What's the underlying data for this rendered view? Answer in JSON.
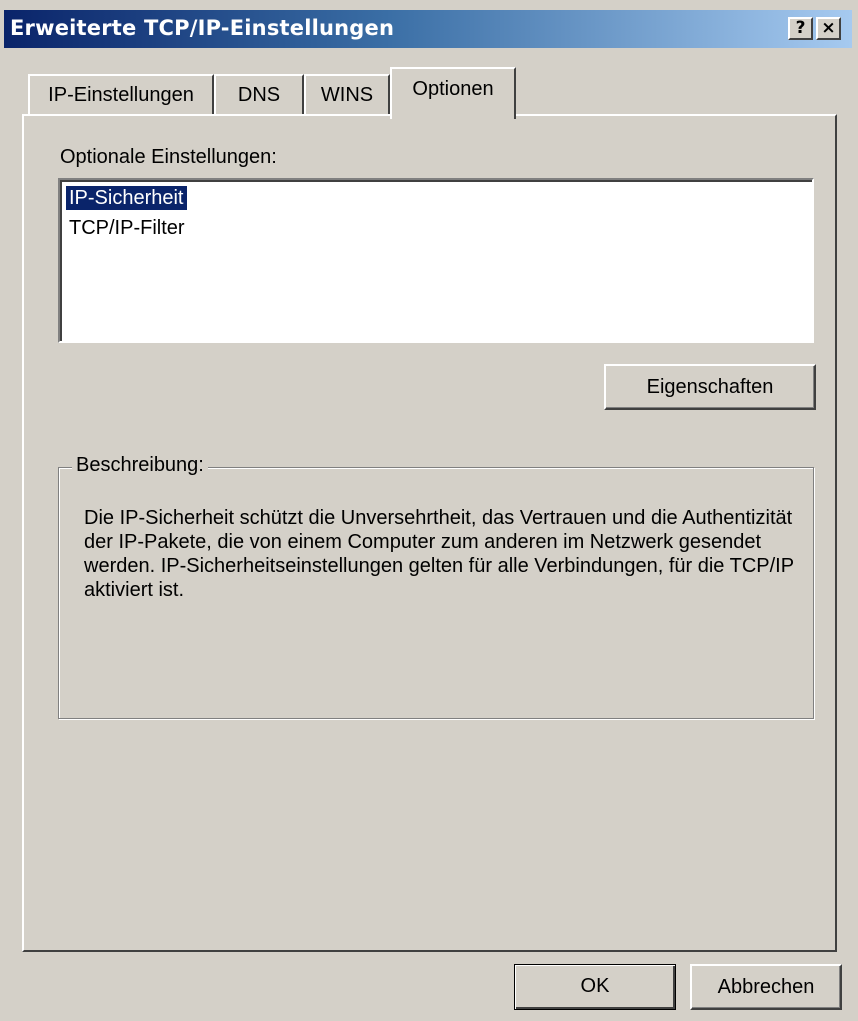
{
  "window": {
    "title": "Erweiterte TCP/IP-Einstellungen",
    "help_button": "?",
    "close_button": "×"
  },
  "tabs": [
    {
      "label": "IP-Einstellungen",
      "active": false
    },
    {
      "label": "DNS",
      "active": false
    },
    {
      "label": "WINS",
      "active": false
    },
    {
      "label": "Optionen",
      "active": true
    }
  ],
  "options": {
    "label": "Optionale Einstellungen:",
    "items": [
      {
        "label": "IP-Sicherheit",
        "selected": true
      },
      {
        "label": "TCP/IP-Filter",
        "selected": false
      }
    ],
    "properties_button": "Eigenschaften"
  },
  "description": {
    "legend": "Beschreibung:",
    "text": "Die IP-Sicherheit schützt die Unversehrtheit, das Vertrauen und die Authentizität der IP-Pakete, die von einem Computer zum anderen im Netzwerk gesendet werden. IP-Sicherheitseinstellungen gelten für alle Verbindungen, für die TCP/IP aktiviert ist."
  },
  "footer": {
    "ok_label": "OK",
    "cancel_label": "Abbrechen"
  },
  "colors": {
    "title_start": "#0a246a",
    "title_end": "#a6caf0",
    "face": "#d4d0c8",
    "selection": "#0a246a"
  }
}
